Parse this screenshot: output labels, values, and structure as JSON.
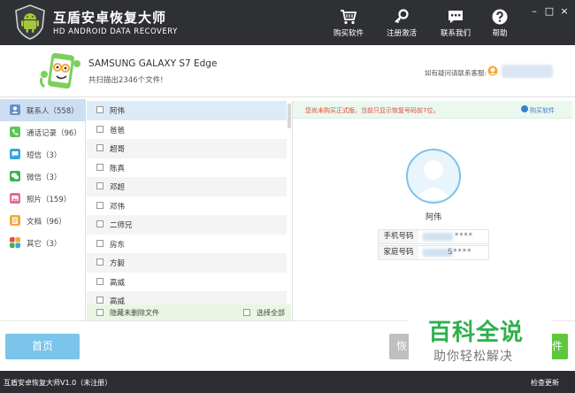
{
  "app": {
    "title": "互盾安卓恢复大师",
    "subtitle": "HD ANDROID DATA RECOVERY"
  },
  "toolbar": {
    "buy": "购买软件",
    "register": "注册激活",
    "contact": "联系我们",
    "help": "帮助"
  },
  "window": {
    "minimize": "–",
    "maximize": "□",
    "close": "×"
  },
  "device": {
    "name": "SAMSUNG  GALAXY S7 Edge",
    "scan_result": "共扫描出2346个文件!",
    "support_text": "如有疑问请联系客服:"
  },
  "sidebar": {
    "items": [
      {
        "label": "联系人（558）",
        "icon": "contacts-icon",
        "color": "#6a8fc7",
        "active": true
      },
      {
        "label": "通话记录（96）",
        "icon": "call-log-icon",
        "color": "#5fc456",
        "active": false
      },
      {
        "label": "短信（3）",
        "icon": "sms-icon",
        "color": "#35a7de",
        "active": false
      },
      {
        "label": "微信（3）",
        "icon": "wechat-icon",
        "color": "#39b54a",
        "active": false
      },
      {
        "label": "照片（159）",
        "icon": "photo-icon",
        "color": "#e86a8e",
        "active": false
      },
      {
        "label": "文档（96）",
        "icon": "document-icon",
        "color": "#f2a93b",
        "active": false
      },
      {
        "label": "其它（3）",
        "icon": "other-icon",
        "color": "#f0a030",
        "active": false
      }
    ]
  },
  "contacts": {
    "items": [
      "阿伟",
      "爸爸",
      "超哥",
      "陈真",
      "邓超",
      "邓伟",
      "二师兄",
      "房东",
      "方毅",
      "高威",
      "高威"
    ],
    "hide_deleted": "隐藏未删除文件",
    "select_all": "选择全部"
  },
  "detail": {
    "notice": "您尚未购买正式版，当前只显示恢复号码前7位。",
    "buy_link": "购买软件",
    "name": "阿伟",
    "fields": [
      {
        "key": "手机号码",
        "value": "****"
      },
      {
        "key": "家庭号码",
        "value": "S****"
      }
    ]
  },
  "actions": {
    "home": "首页",
    "recover": "恢",
    "export": "件"
  },
  "watermark": {
    "main": "百科全说",
    "sub": "助你轻松解决"
  },
  "status": {
    "version": "互盾安卓恢复大师V1.0（未注册）",
    "update": "检查更新"
  }
}
